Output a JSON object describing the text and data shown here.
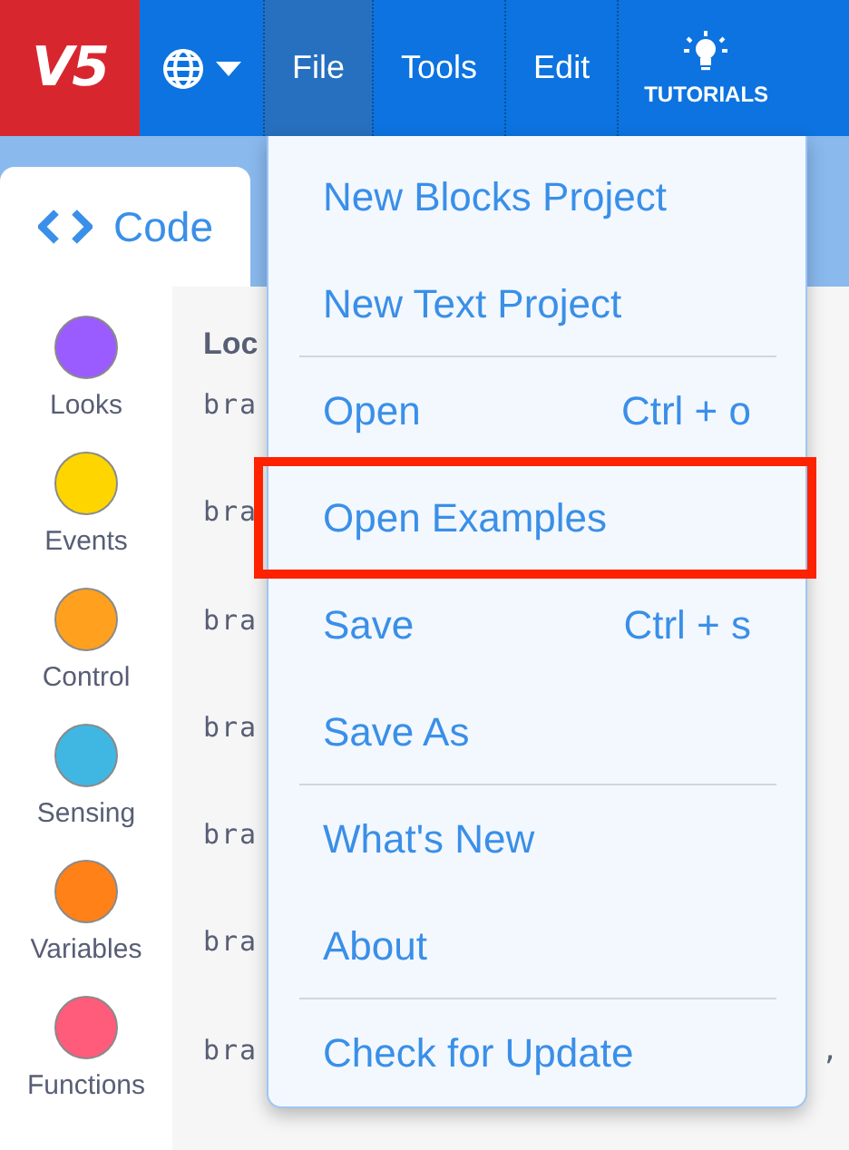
{
  "top_bar": {
    "logo": "V5",
    "menus": [
      {
        "label": "File",
        "selected": true
      },
      {
        "label": "Tools",
        "selected": false
      },
      {
        "label": "Edit",
        "selected": false
      }
    ],
    "tutorials": "TUTORIALS"
  },
  "code_tab": {
    "label": "Code"
  },
  "categories": [
    {
      "label": "Looks",
      "color": "#9a5cff"
    },
    {
      "label": "Events",
      "color": "#ffd500"
    },
    {
      "label": "Control",
      "color": "#ffa01f"
    },
    {
      "label": "Sensing",
      "color": "#40b7e3"
    },
    {
      "label": "Variables",
      "color": "#ff8118"
    },
    {
      "label": "Functions",
      "color": "#ff5b7a"
    }
  ],
  "code": {
    "heading": "Loc",
    "lines": [
      {
        "text": "bra"
      },
      {
        "text": "bra"
      },
      {
        "text": "bra"
      },
      {
        "text": "bra"
      },
      {
        "text": "bra"
      },
      {
        "text": "bra"
      },
      {
        "text": "bra",
        "tail": ","
      }
    ]
  },
  "file_menu": {
    "items": [
      {
        "label": "New Blocks Project",
        "highlighted": false
      },
      {
        "label": "New Text Project",
        "highlighted": false,
        "divider_after": true
      },
      {
        "label": "Open",
        "shortcut": "Ctrl + o",
        "highlighted": false
      },
      {
        "label": "Open Examples",
        "highlighted": true
      },
      {
        "label": "Save",
        "shortcut": "Ctrl + s",
        "highlighted": false
      },
      {
        "label": "Save As",
        "highlighted": false,
        "divider_after": true
      },
      {
        "label": "What's New",
        "highlighted": false
      },
      {
        "label": "About",
        "highlighted": false,
        "divider_after": true
      },
      {
        "label": "Check for Update",
        "highlighted": false
      }
    ]
  }
}
